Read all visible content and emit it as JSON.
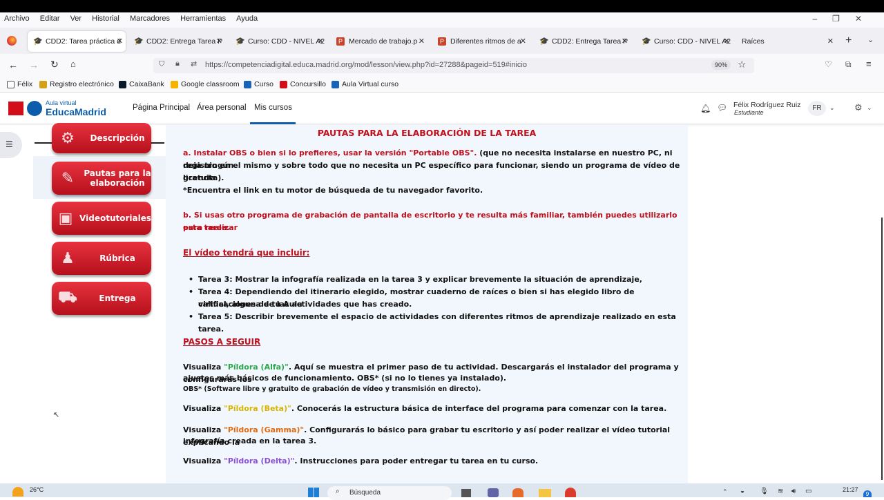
{
  "menubar": [
    "Archivo",
    "Editar",
    "Ver",
    "Historial",
    "Marcadores",
    "Herramientas",
    "Ayuda"
  ],
  "tabs": [
    {
      "label": "CDD2: Tarea práctica d",
      "icon": "moodle-cap-icon"
    },
    {
      "label": "CDD2: Entrega Tarea P",
      "icon": "moodle-cap-icon"
    },
    {
      "label": "Curso: CDD - NIVEL A2",
      "icon": "moodle-cap-icon"
    },
    {
      "label": "Mercado de trabajo.p",
      "icon": "powerpoint-icon"
    },
    {
      "label": "Diferentes ritmos de a",
      "icon": "powerpoint-icon"
    },
    {
      "label": "CDD2: Entrega Tarea P",
      "icon": "moodle-cap-icon"
    },
    {
      "label": "Curso: CDD - NIVEL A2",
      "icon": "moodle-cap-icon"
    },
    {
      "label": "Raíces",
      "icon": ""
    }
  ],
  "url": "https://competenciadigital.educa.madrid.org/mod/lesson/view.php?id=27288&pageid=519#inicio",
  "zoom": "90%",
  "bookmarks": [
    "Félix",
    "Registro electrónico",
    "CaixaBank",
    "Google classroom",
    "Curso",
    "Concursillo",
    "Aula Virtual curso"
  ],
  "site": {
    "logo_top": "Aula virtual",
    "logo_bottom": "EducaMadrid",
    "nav": [
      "Página Principal",
      "Área personal",
      "Mis cursos"
    ],
    "user_name": "Félix Rodríguez Ruiz",
    "user_role": "Estudiante",
    "user_initials": "FR"
  },
  "side_buttons": [
    {
      "label": "Descripción",
      "icon": "gears-icon"
    },
    {
      "label": "Pautas para la elaboración",
      "icon": "document-pencil-icon"
    },
    {
      "label": "Videotutoriales",
      "icon": "monitor-play-icon"
    },
    {
      "label": "Rúbrica",
      "icon": "teacher-icon"
    },
    {
      "label": "Entrega",
      "icon": "delivery-icon"
    }
  ],
  "content": {
    "title": "PAUTAS PARA LA ELABORACIÓN DE LA TAREA",
    "a_red": "a. Instalar OBS o bien si lo prefieres, usar la versión \"Portable OBS\".",
    "a_black1": " (que no necesita instalarse en nuestro PC, ni deja ningún",
    "a_line2": "registro en el mismo y sobre todo que no necesita un PC específico para funcionar, siendo un programa de vídeo de licencia",
    "a_line3": "gratuita).",
    "a_note": "*Encuentra el link en tu motor de búsqueda de tu navegador favorito.",
    "b_line1": "b. Si usas otro programa de grabación de pantalla de escritorio y te resulta más familiar, también puedes utilizarlo para realizar",
    "b_line2": "esta tarea.",
    "video_heading": "El vídeo tendrá que incluir:",
    "bullets": [
      "Tarea 3: Mostrar la infografía realizada en la tarea 3 y explicar brevemente la situación de aprendizaje,",
      "Tarea 4: Dependiendo del itinerario elegido, mostrar cuaderno de raíces o bien si has elegido libro de calificaciones de tu Aula",
      "virtual, alguna de las actividades que has creado.",
      "Tarea 5: Describir brevemente el espacio de actividades con diferentes ritmos de aprendizaje realizado en esta tarea."
    ],
    "steps_heading": "PASOS A SEGUIR",
    "visualiza": "Visualiza ",
    "pill_alfa": "\"Píldora (Alfa)\"",
    "alfa_text1": ". Aquí se muestra el primer paso de tu actividad. Descargarás el instalador del programa y configurarás los",
    "alfa_text2": "ajustes más básicos de funcionamiento. OBS* (si no lo tienes ya instalado).",
    "alfa_note": "OBS* (Software libre y gratuito de grabación de vídeo y transmisión en directo).",
    "pill_beta": "\"Píldora (Beta)\"",
    "beta_text": ". Conocerás la estructura básica de interface del programa para comenzar con la tarea.",
    "pill_gamma": "\"Píldora (Gamma)\"",
    "gamma_text1": ". Configurarás lo básico para grabar tu escritorio y así poder realizar el vídeo tutorial explicando la",
    "gamma_text2": "infografía creada en la tarea 3.",
    "pill_delta": "\"Píldora (Delta)\"",
    "delta_text": ". Instrucciones para poder entregar tu tarea en tu curso."
  },
  "taskbar": {
    "temp": "26°C",
    "search": "Búsqueda",
    "time": "21:27",
    "badge": "9"
  },
  "colors": {
    "red": "#c0101c",
    "alfa": "#2aa84a",
    "beta": "#d9b600",
    "gamma": "#e06a10",
    "delta": "#8a4fd8",
    "educamadrid": "#0b5cab"
  }
}
